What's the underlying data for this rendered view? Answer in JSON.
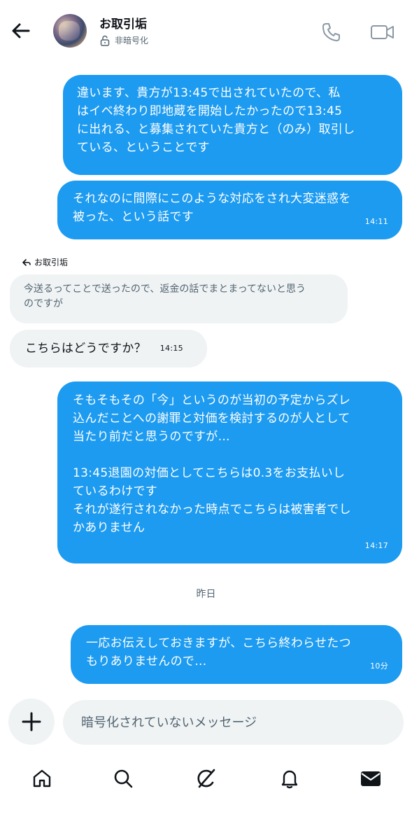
{
  "header": {
    "title": "お取引垢",
    "subtitle": "非暗号化"
  },
  "messages": [
    {
      "text": "違います、貴方が13:45で出されていたので、私\nはイベ終わり即地蔵を開始したかったので13:45\nに出れる、と募集されていた貴方と（のみ）取引し\nている、ということです",
      "time": ""
    },
    {
      "text": "それなのに間際にこのような対応をされ大変迷惑を\n被った、という話です",
      "time": "14:11"
    },
    {
      "text": "そもそもその「今」というのが当初の予定からズレ\n込んだことへの謝罪と対価を検討するのが人として\n当たり前だと思うのですが…\n\n13:45退園の対価としてこちらは0.3をお支払いし\nているわけです\nそれが遂行されなかった時点でこちらは被害者でし\nかありません",
      "time": "14:17"
    },
    {
      "text": "一応お伝えしておきますが、こちら終わらせたつ\nもりありませんので…",
      "time": "10分"
    }
  ],
  "reply": {
    "label": "お取引垢",
    "quoted_text": "今送るってことで送ったので、返金の話でまとまってないと思う\nのですが",
    "text": "こちらはどうですか？",
    "time": "14:15"
  },
  "date_separator": "昨日",
  "composer": {
    "placeholder": "暗号化されていないメッセージ"
  },
  "nav": {
    "icons": [
      "home-icon",
      "search-icon",
      "grok-icon",
      "bell-icon",
      "mail-icon"
    ],
    "active": "mail-icon"
  },
  "colors": {
    "accent": "#1d9bf0",
    "incoming_bg": "#eff3f4",
    "text": "#0f1419",
    "secondary_text": "#536471"
  }
}
